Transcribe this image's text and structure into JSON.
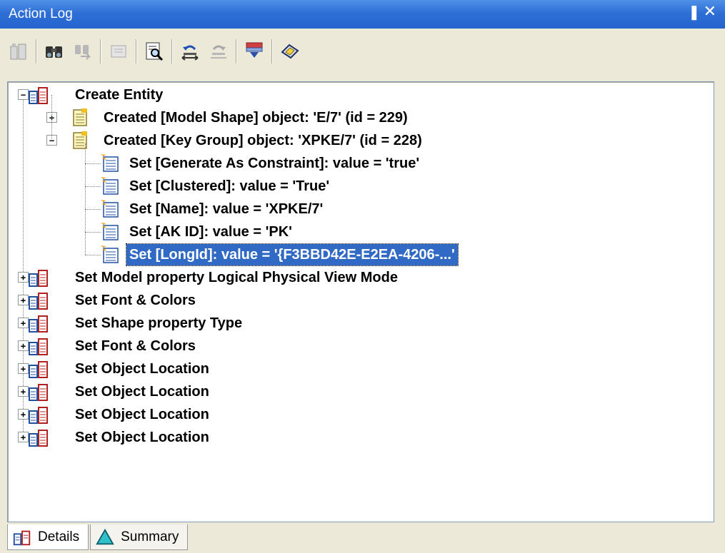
{
  "window": {
    "title": "Action Log",
    "pin_glyph": "▐",
    "close_glyph": "✕"
  },
  "toolbar": {
    "buttons": [
      {
        "name": "undo-group-icon",
        "enabled": false
      },
      {
        "name": "find-icon",
        "enabled": true
      },
      {
        "name": "find-next-icon",
        "enabled": false
      },
      {
        "name": "properties-icon",
        "enabled": false
      },
      {
        "name": "preview-icon",
        "enabled": true
      },
      {
        "name": "undo-to-icon",
        "enabled": true
      },
      {
        "name": "redo-to-icon",
        "enabled": false
      },
      {
        "name": "filter-icon",
        "enabled": true
      },
      {
        "name": "help-icon",
        "enabled": true
      }
    ]
  },
  "tree": {
    "items": [
      {
        "label": "Create Entity",
        "level": 0,
        "icon": "transaction-icon",
        "expander": "−"
      },
      {
        "label": "Created [Model Shape] object: 'E/7' (id = 229)",
        "level": 1,
        "icon": "object-icon",
        "expander": "+"
      },
      {
        "label": "Created [Key Group] object: 'XPKE/7' (id = 228)",
        "level": 1,
        "icon": "object-icon",
        "expander": "−"
      },
      {
        "label": "Set [Generate As Constraint]: value = 'true'",
        "level": 2,
        "icon": "property-icon",
        "expander": ""
      },
      {
        "label": "Set [Clustered]: value = 'True'",
        "level": 2,
        "icon": "property-icon",
        "expander": ""
      },
      {
        "label": "Set [Name]: value = 'XPKE/7'",
        "level": 2,
        "icon": "property-icon",
        "expander": ""
      },
      {
        "label": "Set [AK ID]: value = 'PK'",
        "level": 2,
        "icon": "property-icon",
        "expander": ""
      },
      {
        "label": "Set [LongId]: value = '{F3BBD42E-E2EA-4206-...'",
        "level": 2,
        "icon": "property-icon",
        "expander": "",
        "selected": true
      },
      {
        "label": "Set Model property Logical Physical View Mode",
        "level": 0,
        "icon": "transaction-icon",
        "expander": "+"
      },
      {
        "label": "Set Font & Colors",
        "level": 0,
        "icon": "transaction-icon",
        "expander": "+"
      },
      {
        "label": "Set Shape property Type",
        "level": 0,
        "icon": "transaction-icon",
        "expander": "+"
      },
      {
        "label": "Set Font & Colors",
        "level": 0,
        "icon": "transaction-icon",
        "expander": "+"
      },
      {
        "label": "Set Object Location",
        "level": 0,
        "icon": "transaction-icon",
        "expander": "+"
      },
      {
        "label": "Set Object Location",
        "level": 0,
        "icon": "transaction-icon",
        "expander": "+"
      },
      {
        "label": "Set Object Location",
        "level": 0,
        "icon": "transaction-icon",
        "expander": "+"
      },
      {
        "label": "Set Object Location",
        "level": 0,
        "icon": "transaction-icon",
        "expander": "+"
      }
    ]
  },
  "tabs": [
    {
      "label": "Details",
      "active": true,
      "icon": "details-icon"
    },
    {
      "label": "Summary",
      "active": false,
      "icon": "summary-icon"
    }
  ],
  "colors": {
    "selection": "#316AC5",
    "titlebar": "#2563CF",
    "panel": "#ECE9D8"
  }
}
